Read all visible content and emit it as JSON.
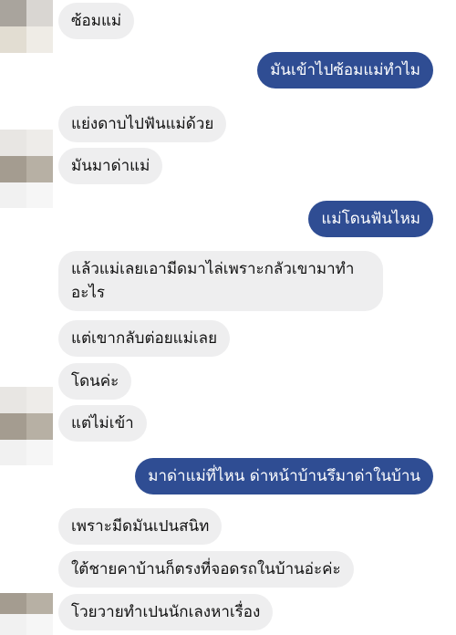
{
  "messages": [
    {
      "side": "in",
      "text": "ซ้อมแม่"
    },
    {
      "side": "out",
      "text": "มันเข้าไปซ้อมแม่ทำไม"
    },
    {
      "side": "in",
      "text": "แย่งดาบไปฟันแม่ด้วย"
    },
    {
      "side": "in",
      "text": "มันมาด่าแม่"
    },
    {
      "side": "out",
      "text": "แม่โดนฟันไหม"
    },
    {
      "side": "in",
      "text": "แล้วแม่เลยเอามีดมาไล่เพราะกลัวเขามาทำอะไร"
    },
    {
      "side": "in",
      "text": "แต่เขากลับต่อยแม่เลย"
    },
    {
      "side": "in",
      "text": "โดนค่ะ"
    },
    {
      "side": "in",
      "text": "แต่ไม่เข้า"
    },
    {
      "side": "out",
      "text": "มาด่าแม่ที่ไหน ด่าหน้าบ้านรึมาด่าในบ้าน"
    },
    {
      "side": "in",
      "text": "เพราะมีดมันเปนสนิท"
    },
    {
      "side": "in",
      "text": "ใต้ชายคาบ้านก็ตรงที่จอดรถในบ้านอ่ะค่ะ"
    },
    {
      "side": "in",
      "text": "โวยวายทำเปนนักเลงหาเรื่อง"
    }
  ],
  "colors": {
    "incoming_bg": "#eeeeef",
    "outgoing_bg": "#2f4d93",
    "outgoing_text": "#ffffff",
    "incoming_text": "#111111"
  }
}
